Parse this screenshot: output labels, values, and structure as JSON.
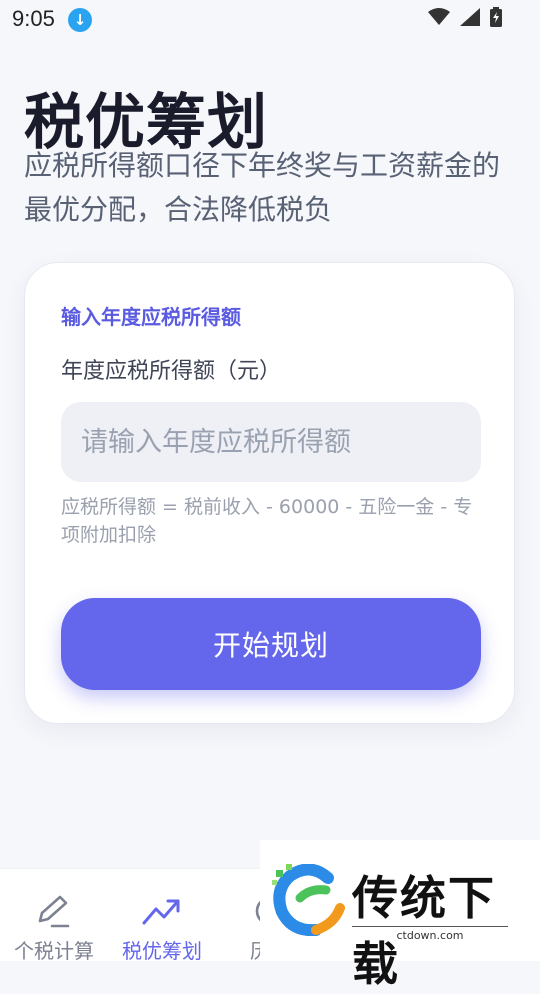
{
  "status_bar": {
    "time": "9:05",
    "icons": [
      "download-icon",
      "wifi-icon",
      "signal-icon",
      "battery-icon"
    ]
  },
  "hero": {
    "title": "税优筹划",
    "subtitle": "应税所得额口径下年终奖与工资薪金的最优分配，合法降低税负"
  },
  "card": {
    "section_title": "输入年度应税所得额",
    "field_label": "年度应税所得额（元）",
    "input_value": "",
    "input_placeholder": "请输入年度应税所得额",
    "hint": "应税所得额 = 税前收入 - 60000 - 五险一金 - 专项附加扣除",
    "button_label": "开始规划"
  },
  "bottom_nav": {
    "items": [
      {
        "label": "个税计算",
        "icon": "pencil-icon",
        "active": false
      },
      {
        "label": "税优筹划",
        "icon": "trend-up-icon",
        "active": true
      },
      {
        "label": "历史",
        "icon": "history-icon",
        "active": false
      }
    ]
  },
  "watermark": {
    "text": "传统下载",
    "url": "ctdown.com"
  },
  "colors": {
    "accent": "#6467ec",
    "section_title": "#5a5be0",
    "background": "#f6f7fb"
  }
}
